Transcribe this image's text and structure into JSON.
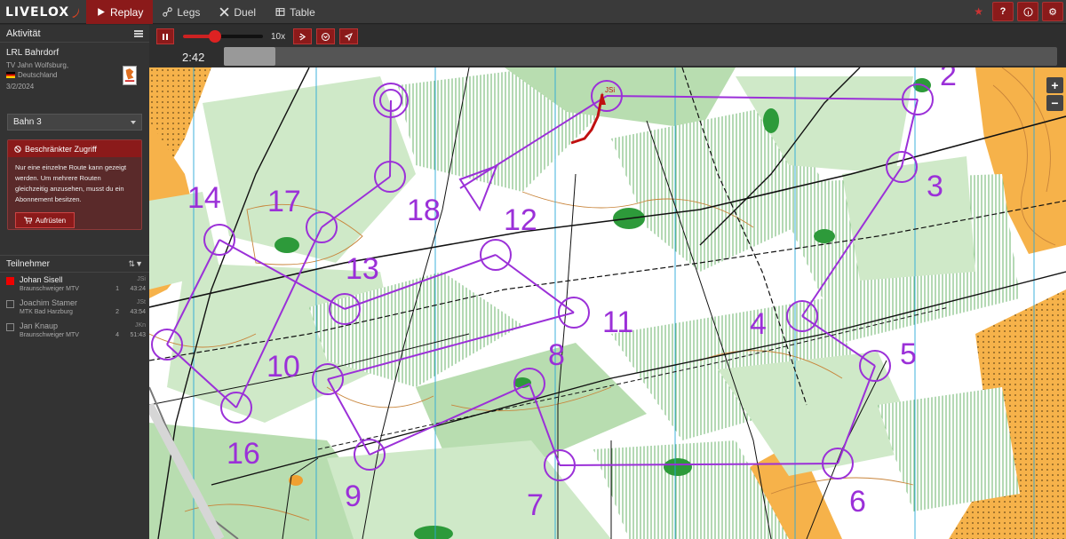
{
  "app": {
    "logo": "LIVELOX",
    "nav": [
      {
        "label": "Replay",
        "icon": "play-icon",
        "active": true
      },
      {
        "label": "Legs",
        "icon": "legs-icon",
        "active": false
      },
      {
        "label": "Duel",
        "icon": "duel-icon",
        "active": false
      },
      {
        "label": "Table",
        "icon": "table-icon",
        "active": false
      }
    ],
    "top_right": {
      "star": "★",
      "help": "?",
      "info": "i",
      "settings": "⚙"
    }
  },
  "sidebar": {
    "activity_header": "Aktivität",
    "event_title": "LRL Bahrdorf",
    "club": "TV Jahn Wolfsburg,",
    "country": "Deutschland",
    "date": "3/2/2024",
    "course": "Bahn 3",
    "restriction": {
      "title": "Beschränkter Zugriff",
      "text": "Nur eine einzelne Route kann gezeigt werden. Um mehrere Routen gleichzeitig anzusehen, musst du ein Abonnement besitzen.",
      "button": "Aufrüsten"
    },
    "participants_header": "Teilnehmer",
    "participants": [
      {
        "name": "Johan Sisell",
        "club": "Braunschweiger MTV",
        "r1": "JSi",
        "rank": "1",
        "time": "43:24",
        "checked": true
      },
      {
        "name": "Joachim Stamer",
        "club": "MTK Bad Harzburg",
        "r1": "JSt",
        "rank": "2",
        "time": "43:54",
        "checked": false
      },
      {
        "name": "Jan Knaup",
        "club": "Braunschweiger MTV",
        "r1": "JKn",
        "rank": "4",
        "time": "51:43",
        "checked": false
      }
    ]
  },
  "playback": {
    "speed": "10x",
    "time": "2:42",
    "slider_fraction": 0.4,
    "timeline_fraction": 0.062
  },
  "map": {
    "runner_tag": "JSi",
    "controls": [
      {
        "label": "2"
      },
      {
        "label": "3"
      },
      {
        "label": "4"
      },
      {
        "label": "5"
      },
      {
        "label": "6"
      },
      {
        "label": "7"
      },
      {
        "label": "8"
      },
      {
        "label": "9"
      },
      {
        "label": "10"
      },
      {
        "label": "11"
      },
      {
        "label": "12"
      },
      {
        "label": "13"
      },
      {
        "label": "14"
      },
      {
        "label": "16"
      },
      {
        "label": "17"
      },
      {
        "label": "18"
      }
    ],
    "zoom_in": "+",
    "zoom_out": "−"
  }
}
